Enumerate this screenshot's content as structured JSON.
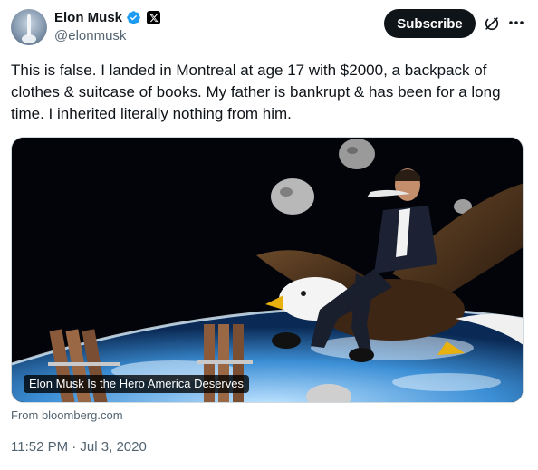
{
  "author": {
    "name": "Elon Musk",
    "handle": "@elonmusk"
  },
  "actions": {
    "subscribe_label": "Subscribe"
  },
  "tweet": {
    "text": "This is false. I landed in Montreal at age 17 with $2000, a backpack of clothes & suitcase of books. My father is bankrupt & has been for a long time. I inherited literally nothing from him."
  },
  "card": {
    "title": "Elon Musk Is the Hero America Deserves",
    "source": "From bloomberg.com"
  },
  "meta": {
    "timestamp": "11:52 PM · Jul 3, 2020"
  },
  "icons": {
    "verified": "verified-badge-icon",
    "platform": "x-logo-icon",
    "grok": "grok-icon",
    "more": "more-icon"
  },
  "colors": {
    "verified_blue": "#1d9bf0",
    "text_primary": "#0f1419",
    "text_secondary": "#536471",
    "subscribe_bg": "#0f1419"
  }
}
